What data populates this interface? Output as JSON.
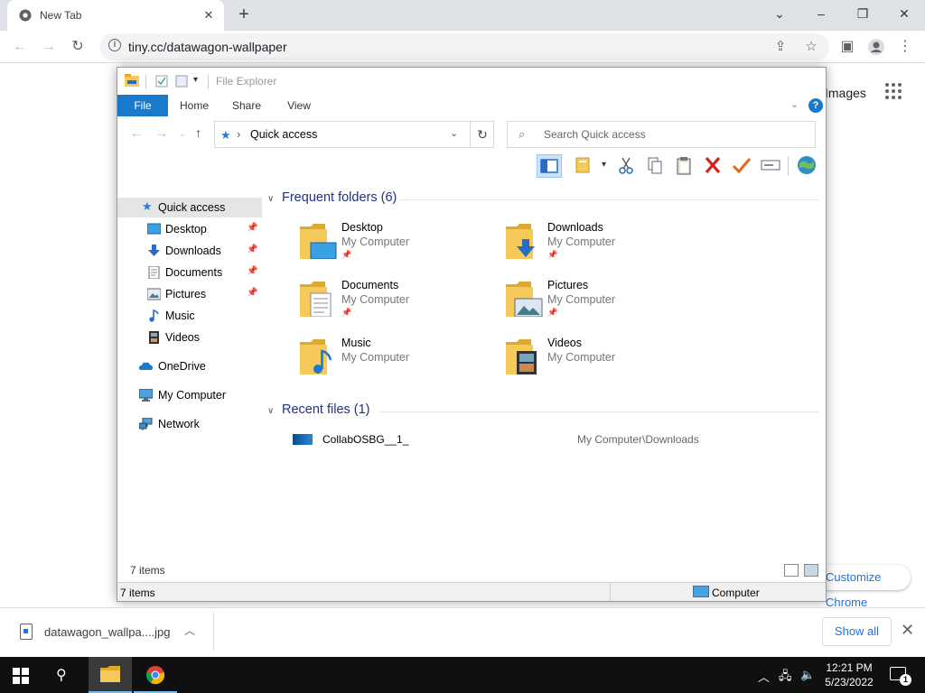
{
  "browser": {
    "tab_title": "New Tab",
    "url": "tiny.cc/datawagon-wallpaper",
    "page_images_link": "Images",
    "page_customize_label": "Customize Chrome"
  },
  "explorer": {
    "title": "File Explorer",
    "ribbon_tabs": [
      "File",
      "Home",
      "Share",
      "View"
    ],
    "address": "Quick access",
    "search_placeholder": "Search Quick access",
    "nav": {
      "quick_access": "Quick access",
      "desktop": "Desktop",
      "downloads": "Downloads",
      "documents": "Documents",
      "pictures": "Pictures",
      "music": "Music",
      "videos": "Videos",
      "onedrive": "OneDrive",
      "my_computer": "My Computer",
      "network": "Network"
    },
    "frequent_header": "Frequent folders (6)",
    "folders": [
      {
        "name": "Desktop",
        "location": "My Computer"
      },
      {
        "name": "Downloads",
        "location": "My Computer"
      },
      {
        "name": "Documents",
        "location": "My Computer"
      },
      {
        "name": "Pictures",
        "location": "My Computer"
      },
      {
        "name": "Music",
        "location": "My Computer"
      },
      {
        "name": "Videos",
        "location": "My Computer"
      }
    ],
    "recent_header": "Recent files (1)",
    "recent_files": [
      {
        "name": "CollabOSBG__1_",
        "path": "My Computer\\Downloads"
      }
    ],
    "status_count": "7 items",
    "status_bar_count": "7 items",
    "status_location": "Computer"
  },
  "download_shelf": {
    "filename": "datawagon_wallpa....jpg",
    "show_all": "Show all"
  },
  "taskbar": {
    "time": "12:21 PM",
    "date": "5/23/2022",
    "notification_count": "1"
  },
  "colors": {
    "accent": "#1979ca",
    "group_header": "#1e3287",
    "folder_yellow": "#f5c95a"
  }
}
